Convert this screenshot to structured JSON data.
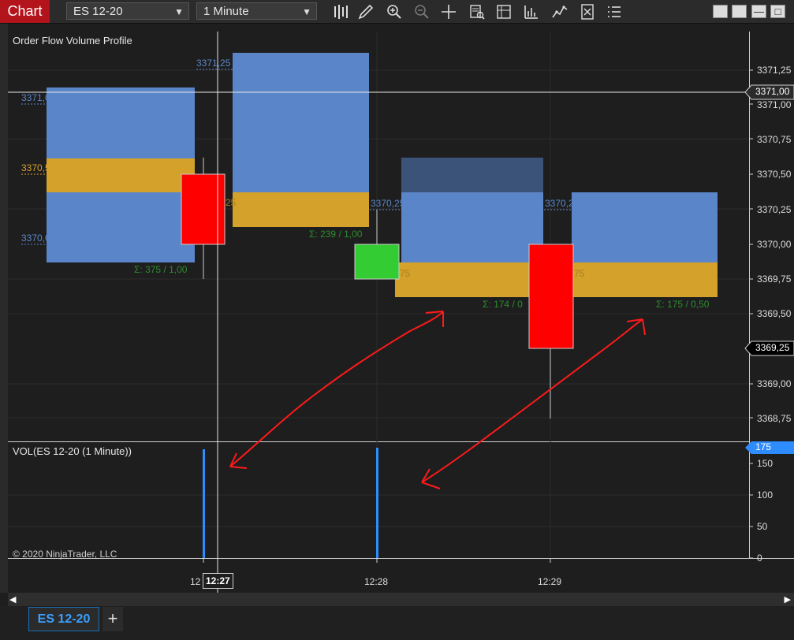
{
  "toolbar": {
    "chart_label": "Chart",
    "instrument": "ES 12-20",
    "interval": "1 Minute",
    "icons": [
      "bar-type-icon",
      "draw-pencil-icon",
      "zoom-in-icon",
      "zoom-out-icon",
      "crosshair-icon",
      "data-box-icon",
      "chart-trader-icon",
      "indicators-icon",
      "strategies-icon",
      "properties-icon",
      "templates-icon"
    ]
  },
  "panels": {
    "main_title": "Order Flow Volume Profile",
    "volume_title": "VOL(ES 12-20 (1 Minute))",
    "copyright": "© 2020 NinjaTrader, LLC"
  },
  "profile_labels": {
    "p1_high": "3371,00",
    "p1_mid": "3370,50",
    "p1_low": "3370,00",
    "p1_sum": "Σ: 375 / 1,00",
    "p2_top": "3371,25",
    "p2_poc": "25",
    "p2_sum": "Σ: 239 / 1,00",
    "p3_top": "3370,25",
    "p3_poc": "75",
    "p3_sum": "Σ: 174 / 0",
    "p4_top": "3370,25",
    "p4_poc": "75",
    "p4_sum": "Σ: 175 / 0,50"
  },
  "price_axis": {
    "labels": [
      "3371,25",
      "3371,00",
      "3370,75",
      "3370,50",
      "3370,25",
      "3370,00",
      "3369,75",
      "3369,50",
      "3369,00",
      "3368,75"
    ],
    "current_price": "3371,00",
    "last_price": "3369,25"
  },
  "volume_axis": {
    "labels": [
      "150",
      "100",
      "50",
      "0"
    ],
    "current": "175"
  },
  "time_axis": {
    "labels": [
      "12:28",
      "12:29"
    ],
    "crosshair_time": "12:27",
    "partial": "12"
  },
  "tabs": [
    {
      "label": "ES 12-20"
    }
  ],
  "tab_add": "+",
  "colors": {
    "profile_blue": "#5b85c9",
    "poc_gold": "#d4a12a",
    "bear_candle": "#ff0000",
    "bull_candle": "#33cc33",
    "volume_bar": "#2f8cff",
    "brand_red": "#b3141b"
  }
}
